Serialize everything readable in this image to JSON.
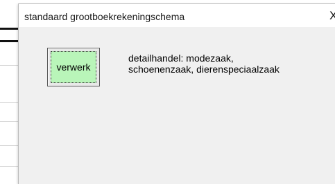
{
  "dialog": {
    "title": "standaard grootboekrekeningschema",
    "close_glyph": "X",
    "close_icon": "close-icon"
  },
  "button": {
    "label": "verwerk",
    "fill_color": "#b9f5b9"
  },
  "description": {
    "line1": "detailhandel: modezaak,",
    "line2": "schoenenzaak, dierenspeciaalzaak"
  }
}
